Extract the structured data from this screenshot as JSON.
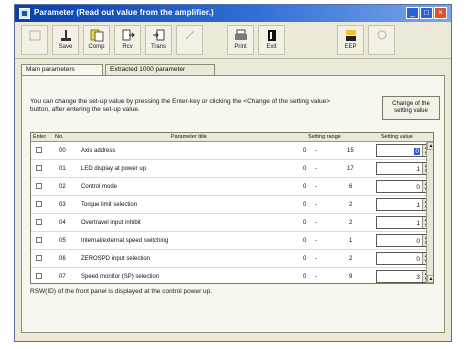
{
  "window": {
    "title": "Parameter (Read out value from the amplifier.)",
    "buttons": {
      "minimize": "_",
      "maximize": "□",
      "close": "×"
    }
  },
  "toolbar": {
    "items": [
      {
        "label": "",
        "icon": "disabled-icon",
        "enabled": false
      },
      {
        "label": "Save",
        "icon": "save-icon",
        "enabled": true
      },
      {
        "label": "Comp",
        "icon": "compare-icon",
        "enabled": true
      },
      {
        "label": "Rcv",
        "icon": "receive-icon",
        "enabled": true
      },
      {
        "label": "Trans",
        "icon": "transmit-icon",
        "enabled": true
      },
      {
        "label": "",
        "icon": "disabled-icon",
        "enabled": false
      },
      {
        "label": "Print",
        "icon": "print-icon",
        "enabled": true
      },
      {
        "label": "Exit",
        "icon": "exit-icon",
        "enabled": true
      },
      {
        "label": "EEP",
        "icon": "eeprom-icon",
        "enabled": true
      },
      {
        "label": "",
        "icon": "disabled-icon",
        "enabled": false
      }
    ]
  },
  "tabs": [
    {
      "label": "Main parameters",
      "active": true
    },
    {
      "label": "Extracted 1000 parameter",
      "active": false
    }
  ],
  "info_text": "You can change the set-up value by pressing the Enter-key or clicking the <Change of the setting value> button, after entering the set-up value.",
  "change_button": "Change of the setting value",
  "grid": {
    "headers": {
      "enter": "Enter",
      "no": "No.",
      "title": "Parameter title",
      "range": "Setting range",
      "value": "Setting value"
    },
    "rows": [
      {
        "no": "00",
        "title": "Axis address",
        "range_min": "0",
        "range_sep": "-",
        "range_max": "15",
        "value": "0",
        "selected": true
      },
      {
        "no": "01",
        "title": "LED display at power up",
        "range_min": "0",
        "range_sep": "-",
        "range_max": "17",
        "value": "1",
        "selected": false
      },
      {
        "no": "02",
        "title": "Control mode",
        "range_min": "0",
        "range_sep": "-",
        "range_max": "6",
        "value": "0",
        "selected": false
      },
      {
        "no": "03",
        "title": "Torque limit selection",
        "range_min": "0",
        "range_sep": "-",
        "range_max": "2",
        "value": "1",
        "selected": false
      },
      {
        "no": "04",
        "title": "Overtravel input inhibit",
        "range_min": "0",
        "range_sep": "-",
        "range_max": "2",
        "value": "1",
        "selected": false
      },
      {
        "no": "05",
        "title": "Internal/external speed switching",
        "range_min": "0",
        "range_sep": "-",
        "range_max": "1",
        "value": "0",
        "selected": false
      },
      {
        "no": "06",
        "title": "ZEROSPD input selection",
        "range_min": "0",
        "range_sep": "-",
        "range_max": "2",
        "value": "0",
        "selected": false
      },
      {
        "no": "07",
        "title": "Speed monitor (SP) selection",
        "range_min": "0",
        "range_sep": "-",
        "range_max": "9",
        "value": "3",
        "selected": false
      }
    ]
  },
  "status_text": "RSW(ID) of the front panel is displayed at the control power up.",
  "colors": {
    "title_bar": "#0a3fa8",
    "selection": "#1f5bd6",
    "window_bg": "#ece9d8"
  }
}
